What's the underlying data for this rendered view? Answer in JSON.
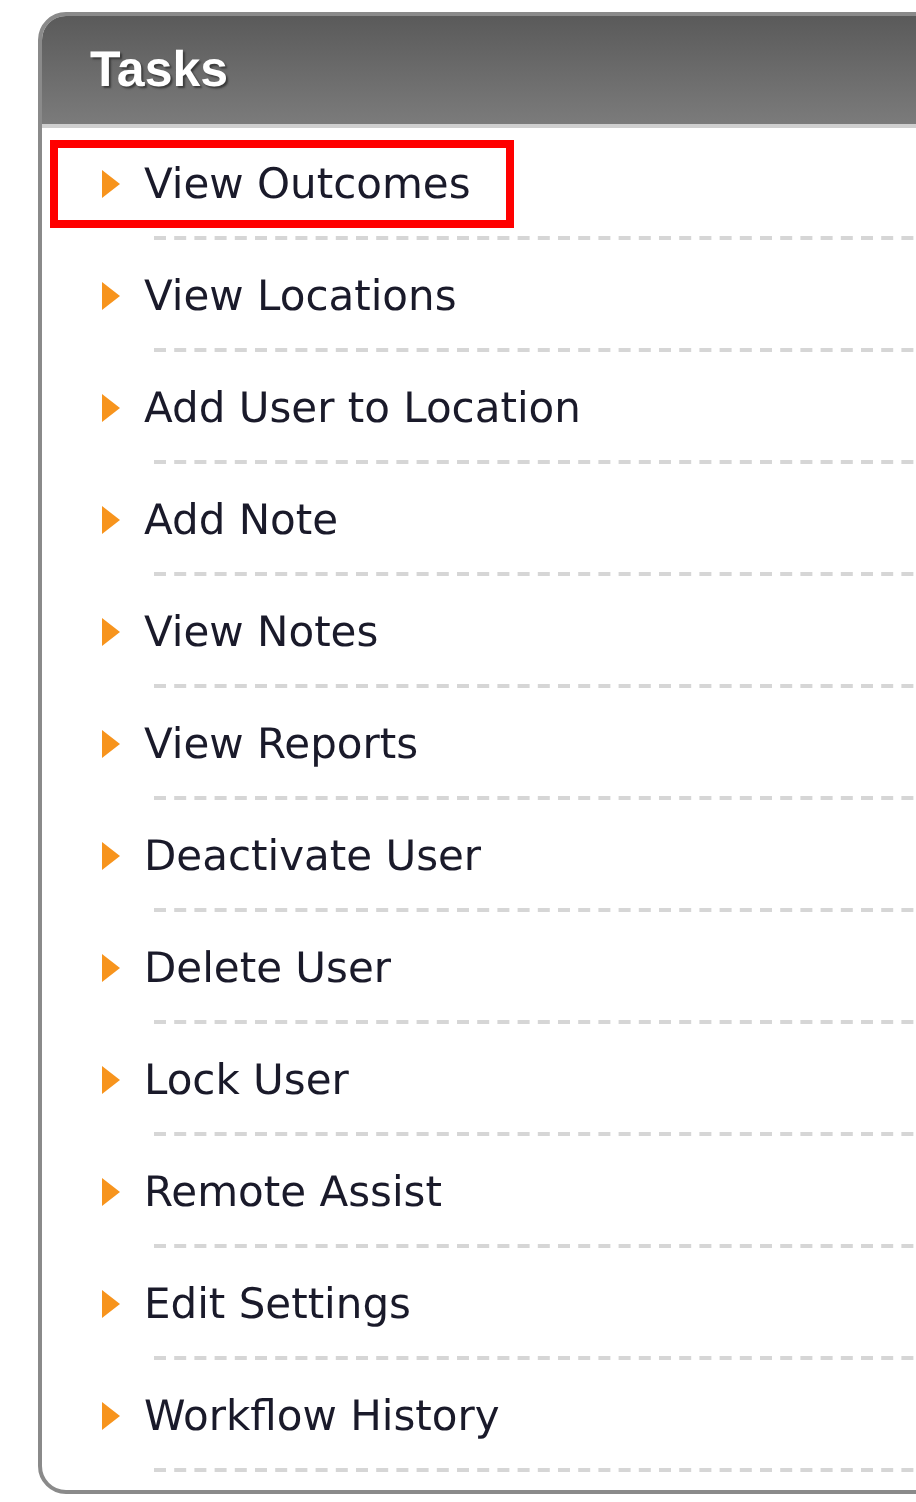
{
  "panel": {
    "title": "Tasks"
  },
  "items": [
    {
      "label": "View Outcomes",
      "highlighted": true
    },
    {
      "label": "View Locations",
      "highlighted": false
    },
    {
      "label": "Add User to Location",
      "highlighted": false
    },
    {
      "label": "Add Note",
      "highlighted": false
    },
    {
      "label": "View Notes",
      "highlighted": false
    },
    {
      "label": "View Reports",
      "highlighted": false
    },
    {
      "label": "Deactivate User",
      "highlighted": false
    },
    {
      "label": "Delete User",
      "highlighted": false
    },
    {
      "label": "Lock User",
      "highlighted": false
    },
    {
      "label": "Remote Assist",
      "highlighted": false
    },
    {
      "label": "Edit Settings",
      "highlighted": false
    },
    {
      "label": "Workflow History",
      "highlighted": false
    }
  ]
}
